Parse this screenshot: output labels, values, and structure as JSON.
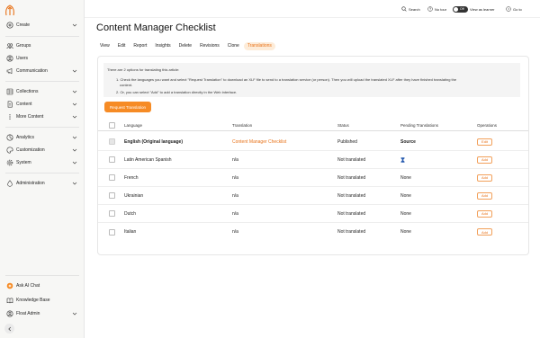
{
  "sidebar": {
    "items": [
      {
        "label": "Create"
      },
      {
        "label": "Groups"
      },
      {
        "label": "Users"
      },
      {
        "label": "Communication"
      },
      {
        "label": "Collections"
      },
      {
        "label": "Content"
      },
      {
        "label": "More Content"
      },
      {
        "label": "Analytics"
      },
      {
        "label": "Customization"
      },
      {
        "label": "System"
      },
      {
        "label": "Administration"
      }
    ],
    "bottom": [
      {
        "label": "Ask AI Chat"
      },
      {
        "label": "Knowledge Base"
      },
      {
        "label": "Float Admin"
      }
    ]
  },
  "topbar": {
    "search": "Search",
    "no_tour": "No tour",
    "toggle_state": "Off",
    "view_as_learner": "View as learner",
    "goto": "Go to"
  },
  "page": {
    "title": "Content Manager Checklist",
    "tabs": [
      "View",
      "Edit",
      "Report",
      "Insights",
      "Delete",
      "Revisions",
      "Clone",
      "Translations"
    ],
    "active_tab": "Translations"
  },
  "info": {
    "intro": "There are 2 options for translating this article:",
    "option1_a": "1.  Check the languages you want and select \"Request Translation\" to download an XLF file to send to a translation service (or person). Then you will upload the translated XLF after they have finished translating the",
    "option1_b": "content.",
    "option2": "2.  Or, you can select \"Add\" to add a translation directly in the Web interface."
  },
  "request_button": "Request Translation",
  "table": {
    "headers": {
      "language": "Language",
      "translation": "Translation",
      "status": "Status",
      "pending": "Pending Translations",
      "operations": "Operations"
    },
    "rows": [
      {
        "language": "English (Original language)",
        "translation": "Content Manager Checklist",
        "status": "Published",
        "pending": "Source",
        "operation": "Edit"
      },
      {
        "language": "Latin American Spanish",
        "translation": "n/a",
        "status": "Not translated",
        "pending": "",
        "operation": "Add"
      },
      {
        "language": "French",
        "translation": "n/a",
        "status": "Not translated",
        "pending": "None",
        "operation": "Add"
      },
      {
        "language": "Ukrainian",
        "translation": "n/a",
        "status": "Not translated",
        "pending": "None",
        "operation": "Add"
      },
      {
        "language": "Dutch",
        "translation": "n/a",
        "status": "Not translated",
        "pending": "None",
        "operation": "Add"
      },
      {
        "language": "Italian",
        "translation": "n/a",
        "status": "Not translated",
        "pending": "None",
        "operation": "Add"
      }
    ]
  },
  "colors": {
    "accent": "#f68b25",
    "accent_text": "#e8731a",
    "tab_active_bg": "#fdecd9",
    "info_bg": "#f4f4f4",
    "hourglass": "#2a5db0"
  }
}
